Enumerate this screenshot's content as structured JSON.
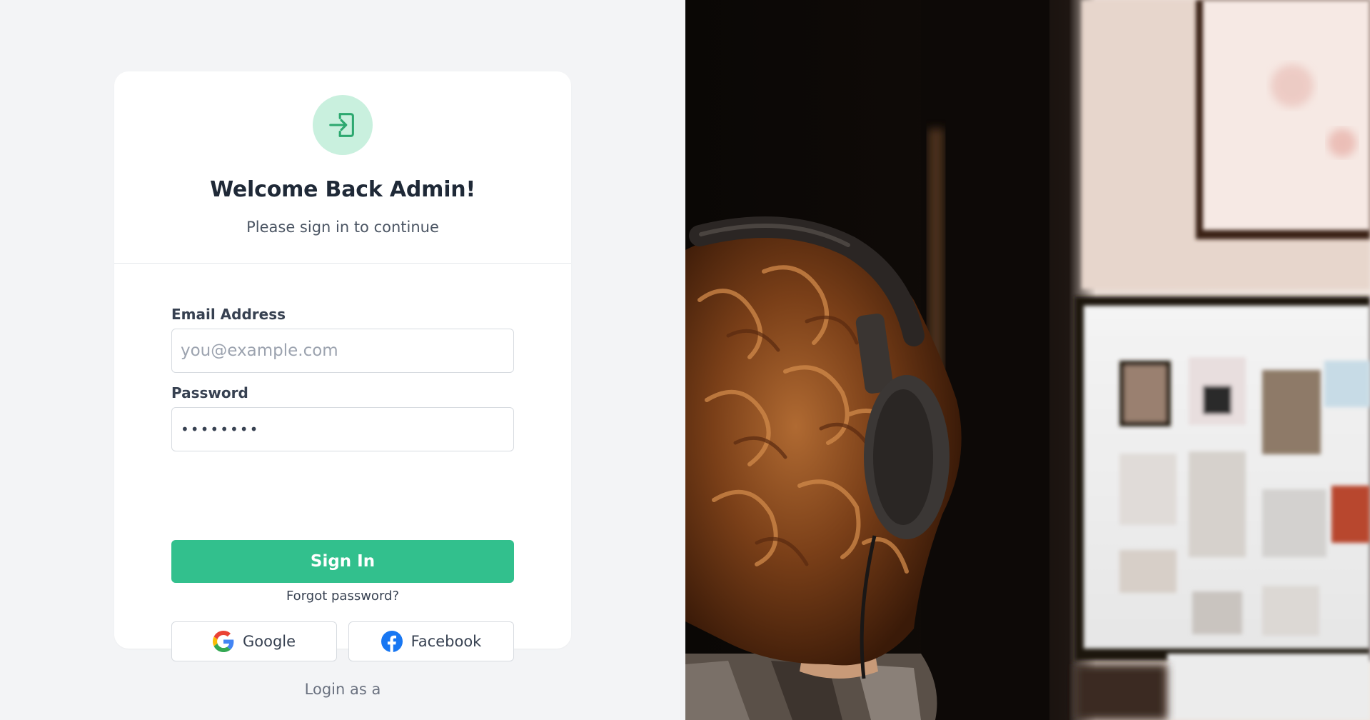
{
  "card": {
    "title": "Welcome Back Admin!",
    "subtitle": "Please sign in to continue",
    "logo_icon": "sign-in-icon"
  },
  "form": {
    "email_label": "Email Address",
    "email_placeholder": "you@example.com",
    "email_value": "",
    "password_label": "Password",
    "password_value": "••••••••",
    "signin_label": "Sign In",
    "forgot_label": "Forgot password?"
  },
  "social": {
    "google_label": "Google",
    "facebook_label": "Facebook"
  },
  "footer": {
    "login_as": "Login as a"
  },
  "colors": {
    "accent": "#32c08d",
    "accent_light": "#c9f0de",
    "background": "#f3f4f6",
    "title": "#1f2937"
  }
}
